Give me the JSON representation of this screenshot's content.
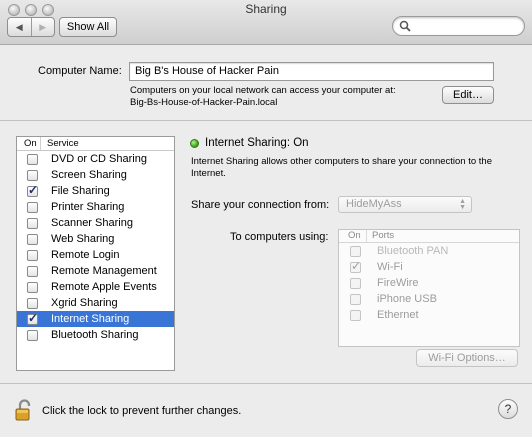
{
  "window": {
    "title": "Sharing"
  },
  "toolbar": {
    "back_glyph": "◀",
    "forward_glyph": "▶",
    "show_all_label": "Show All",
    "search_placeholder": "",
    "search_value": ""
  },
  "computer_name": {
    "label": "Computer Name:",
    "value": "Big B's House of Hacker Pain",
    "note_line1": "Computers on your local network can access your computer at:",
    "note_line2": "Big-Bs-House-of-Hacker-Pain.local",
    "edit_label": "Edit…"
  },
  "services": {
    "header_on": "On",
    "header_service": "Service",
    "selected_color": "#3875d7",
    "items": [
      {
        "label": "DVD or CD Sharing",
        "on": false
      },
      {
        "label": "Screen Sharing",
        "on": false
      },
      {
        "label": "File Sharing",
        "on": true
      },
      {
        "label": "Printer Sharing",
        "on": false
      },
      {
        "label": "Scanner Sharing",
        "on": false
      },
      {
        "label": "Web Sharing",
        "on": false
      },
      {
        "label": "Remote Login",
        "on": false
      },
      {
        "label": "Remote Management",
        "on": false
      },
      {
        "label": "Remote Apple Events",
        "on": false
      },
      {
        "label": "Xgrid Sharing",
        "on": false
      },
      {
        "label": "Internet Sharing",
        "on": true,
        "selected": true
      },
      {
        "label": "Bluetooth Sharing",
        "on": false
      }
    ]
  },
  "detail": {
    "status_color": "#3aa51a",
    "status_title": "Internet Sharing: On",
    "description": "Internet Sharing allows other computers to share your connection to the Internet.",
    "share_from_label": "Share your connection from:",
    "share_from_value": "HideMyAss",
    "to_computers_label": "To computers using:",
    "ports_header_on": "On",
    "ports_header_ports": "Ports",
    "ports": [
      {
        "label": "Bluetooth PAN",
        "on": false
      },
      {
        "label": "Wi-Fi",
        "on": true
      },
      {
        "label": "FireWire",
        "on": false
      },
      {
        "label": "iPhone USB",
        "on": false
      },
      {
        "label": "Ethernet",
        "on": false
      }
    ],
    "wifi_options_label": "Wi-Fi Options…"
  },
  "footer": {
    "lock_text": "Click the lock to prevent further changes.",
    "help_glyph": "?"
  }
}
